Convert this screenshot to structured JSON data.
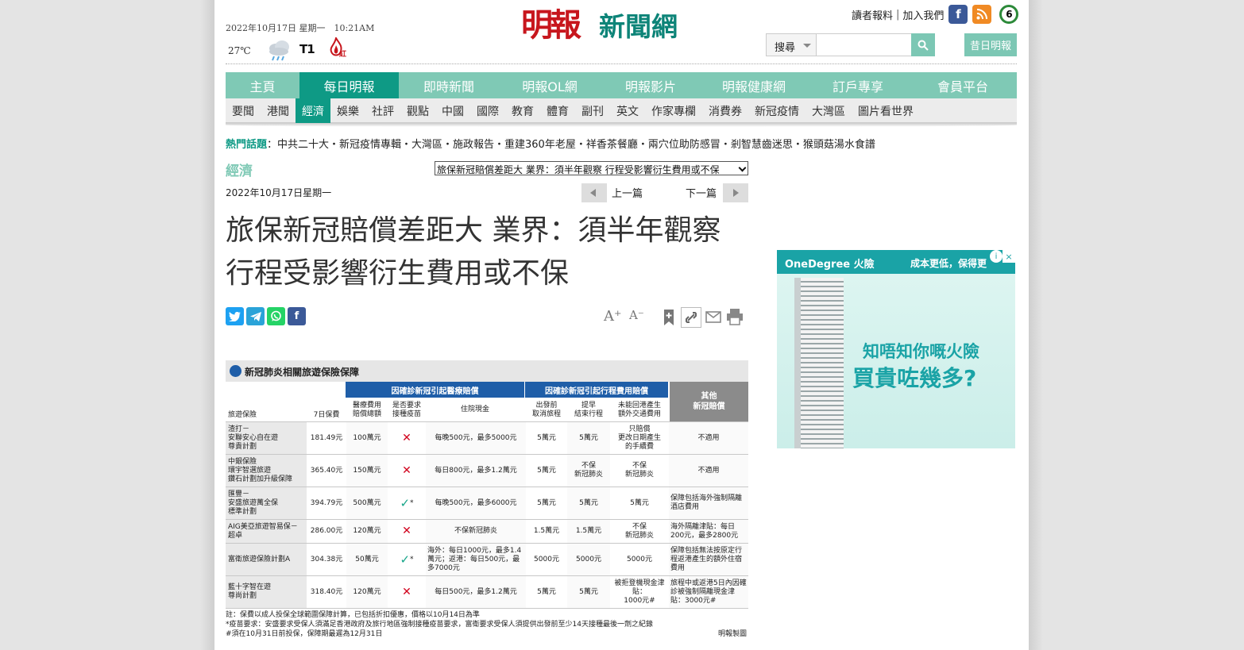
{
  "header": {
    "date": "2022年10月17日 星期一　10:21AM",
    "temperature": "27℃",
    "typhoon_signal": "T1",
    "fire_warning": "紅",
    "logo_ming": "明報",
    "logo_news": "新聞網",
    "feedback_link": "讀者報料",
    "join_link": "加入我們",
    "search_scope": "搜尋",
    "search_placeholder": "",
    "past_issue_button": "昔日明報",
    "social_icons": [
      "facebook-icon",
      "rss-icon",
      "channel-6-icon"
    ]
  },
  "main_nav": [
    "主頁",
    "每日明報",
    "即時新聞",
    "明報OL網",
    "明報影片",
    "明報健康網",
    "訂戶專享",
    "會員平台"
  ],
  "main_nav_active": 1,
  "sub_nav": [
    "要聞",
    "港聞",
    "經濟",
    "娛樂",
    "社評",
    "觀點",
    "中國",
    "國際",
    "教育",
    "體育",
    "副刊",
    "英文",
    "作家專欄",
    "消費券",
    "新冠疫情",
    "大灣區",
    "圖片看世界"
  ],
  "sub_nav_active": 2,
  "hot_topics": {
    "label": "熱門話題",
    "text": "：中共二十大・新冠疫情專輯・大灣區・施政報告・重建360年老屋・祥香茶餐廳・兩穴位助防感冒・剎智慧齒迷思・猴頭菇湯水食譜"
  },
  "article": {
    "section": "經濟",
    "select_value": "旅保新冠賠償差距大 業界：須半年觀察 行程受影響衍生費用或不保",
    "date": "2022年10月17日星期一",
    "prev_label": "上一篇",
    "next_label": "下一篇",
    "headline": "旅保新冠賠償差距大 業界：須半年觀察 行程受影響衍生費用或不保",
    "font_larger": "A⁺",
    "font_smaller": "A⁻"
  },
  "table": {
    "title": "新冠肺炎相關旅遊保險保障",
    "group_medical": "因確診新冠引起醫療賠償",
    "group_travel": "因確診新冠引起行程費用賠償",
    "group_other": "其他\n新冠賠償",
    "headers": [
      "旅遊保險",
      "7日保費",
      "醫療費用\n賠償總額",
      "是否要求\n接種疫苗",
      "住院現金",
      "出發前\n取消旅程",
      "提早\n結束行程",
      "未能回港產生\n額外交通費用"
    ],
    "rows": [
      {
        "plan": "渣打－\n安聯安心自在遊\n尊貴計劃",
        "premium": "181.49元",
        "medical": "100萬元",
        "vaccine": "x",
        "hospital": "每晚500元，最多5000元",
        "cancel": "5萬元",
        "early": "5萬元",
        "transport": "只賠償\n更改日期產生\n的手續費",
        "other": "不適用"
      },
      {
        "plan": "中銀保險\n環宇智選旅遊\n鑽石計劃加升級保障",
        "premium": "365.40元",
        "medical": "150萬元",
        "vaccine": "x",
        "hospital": "每日800元，最多1.2萬元",
        "cancel": "5萬元",
        "early": "不保\n新冠肺炎",
        "transport": "不保\n新冠肺炎",
        "other": "不適用"
      },
      {
        "plan": "匯豐－\n安盛旅遊萬全保\n標準計劃",
        "premium": "394.79元",
        "medical": "500萬元",
        "vaccine": "ok",
        "hospital": "每晚500元，最多6000元",
        "cancel": "5萬元",
        "early": "5萬元",
        "transport": "5萬元",
        "other": "保障包括海外強制隔離酒店費用"
      },
      {
        "plan": "AIG美亞旅遊智易保－\n超卓",
        "premium": "286.00元",
        "medical": "120萬元",
        "vaccine": "x",
        "hospital": "不保新冠肺炎",
        "cancel": "1.5萬元",
        "early": "1.5萬元",
        "transport": "不保\n新冠肺炎",
        "other": "海外隔離津貼：每日200元，最多2800元"
      },
      {
        "plan": "富衛旅遊保險計劃A",
        "premium": "304.38元",
        "medical": "50萬元",
        "vaccine": "ok",
        "hospital": "海外：每日1000元，最多1.4萬元；返港：每日500元，最多7000元",
        "cancel": "5000元",
        "early": "5000元",
        "transport": "5000元",
        "other": "保障包括無法按原定行程返港產生的額外住宿費用"
      },
      {
        "plan": "藍十字智在遊\n尊尚計劃",
        "premium": "318.40元",
        "medical": "120萬元",
        "vaccine": "x",
        "hospital": "每日500元，最多1.2萬元",
        "cancel": "5萬元",
        "early": "5萬元",
        "transport": "被拒登機現金津貼：\n1000元#",
        "other": "旅程中或返港5日內因確診被強制隔離現金津貼：3000元#"
      }
    ],
    "note1": "註：保費以成人投保全球範圍保障計算，已包括折扣優惠，價格以10月14日為準",
    "note2": "*疫苗要求：安盛要求受保人須滿足香港政府及旅行地區強制接種疫苗要求，富衛要求受保人須提供出發前至少14天接種最後一劑之紀錄",
    "note3": "#須在10月31日前投保，保障期最遲為12月31日",
    "credit": "明報製圖"
  },
  "ad": {
    "brand": "OneDegree 火險",
    "slogan": "成本更低，保得更",
    "line1": "知唔知你嘅火險",
    "line2": "買貴咗幾多?",
    "close": "×",
    "info": "i"
  }
}
